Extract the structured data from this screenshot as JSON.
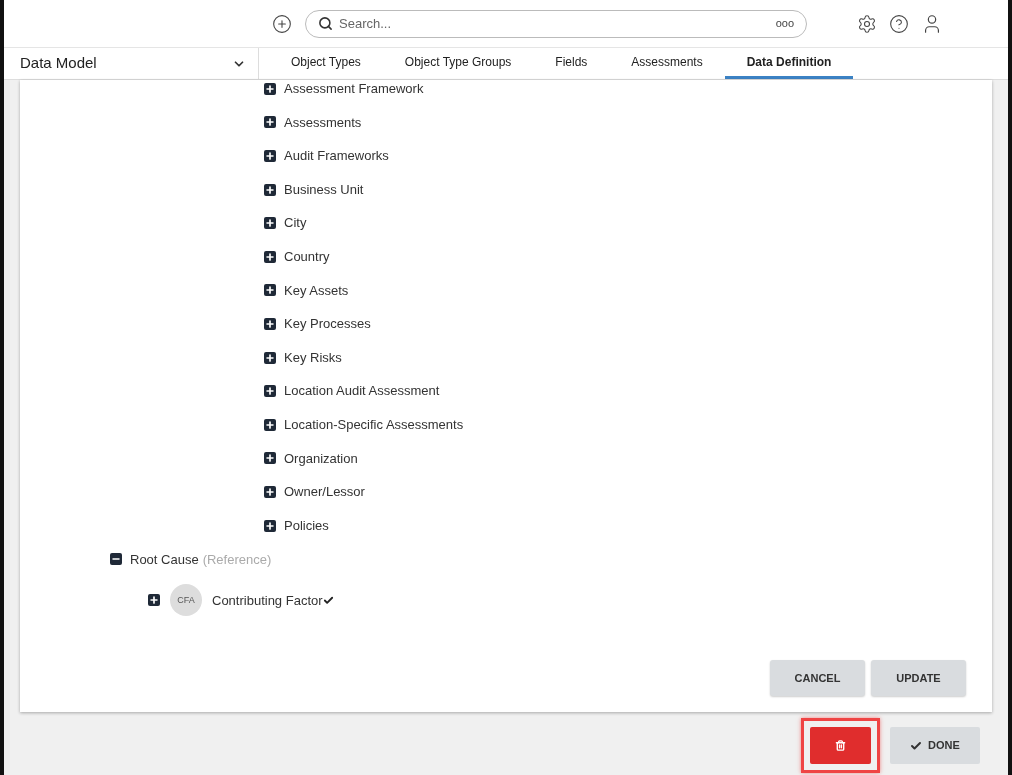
{
  "top_bar": {
    "search": {
      "placeholder": "Search..."
    },
    "search_more": "ooo"
  },
  "app_selector": {
    "label": "Data Model"
  },
  "tabs": [
    {
      "label": "Object Types",
      "selected": false
    },
    {
      "label": "Object Type Groups",
      "selected": false
    },
    {
      "label": "Fields",
      "selected": false
    },
    {
      "label": "Assessments",
      "selected": false
    },
    {
      "label": "Data Definition",
      "selected": true
    }
  ],
  "object_types": [
    {
      "label": "Assessment Framework",
      "expanded": false
    },
    {
      "label": "Assessments",
      "expanded": false
    },
    {
      "label": "Audit Frameworks",
      "expanded": false
    },
    {
      "label": "Business Unit",
      "expanded": false
    },
    {
      "label": "City",
      "expanded": false
    },
    {
      "label": "Country",
      "expanded": false
    },
    {
      "label": "Key Assets",
      "expanded": false
    },
    {
      "label": "Key Processes",
      "expanded": false
    },
    {
      "label": "Key Risks",
      "expanded": false
    },
    {
      "label": "Location Audit Assessment",
      "expanded": false
    },
    {
      "label": "Location-Specific Assessments",
      "expanded": false
    },
    {
      "label": "Organization",
      "expanded": false
    },
    {
      "label": "Owner/Lessor",
      "expanded": false
    },
    {
      "label": "Policies",
      "expanded": false
    }
  ],
  "reference_tree": [
    {
      "label": "Root Cause",
      "note": "(Reference)",
      "expanded": true,
      "children": [
        {
          "label": "Contributing Factor",
          "avatar": "CFA",
          "checked": true,
          "expanded": false
        }
      ]
    }
  ],
  "form_buttons": [
    "CANCEL",
    "UPDATE"
  ],
  "footer": {
    "delete_highlighted": true,
    "done": "DONE"
  }
}
